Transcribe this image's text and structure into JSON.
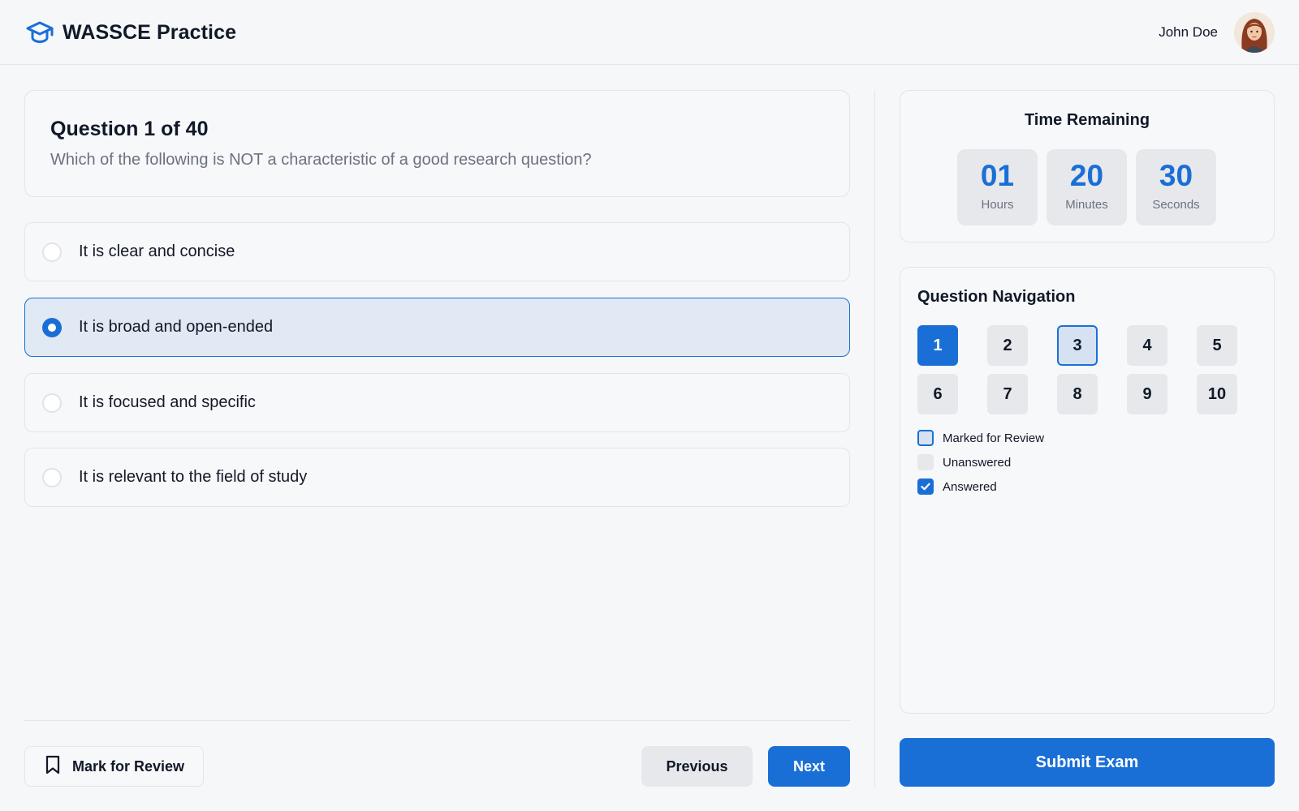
{
  "header": {
    "brand_title": "WASSCE Practice",
    "brand_icon": "graduation-cap-icon",
    "user_name": "John Doe"
  },
  "question": {
    "title": "Question 1 of 40",
    "text": "Which of the following is NOT a characteristic of a good research question?",
    "options": [
      {
        "label": "It is clear and concise",
        "selected": false
      },
      {
        "label": "It is broad and open-ended",
        "selected": true
      },
      {
        "label": "It is focused and specific",
        "selected": false
      },
      {
        "label": "It is relevant to the field of study",
        "selected": false
      }
    ]
  },
  "actions": {
    "mark_review_label": "Mark for Review",
    "previous_label": "Previous",
    "next_label": "Next",
    "submit_label": "Submit Exam"
  },
  "timer": {
    "title": "Time Remaining",
    "hours": "01",
    "hours_label": "Hours",
    "minutes": "20",
    "minutes_label": "Minutes",
    "seconds": "30",
    "seconds_label": "Seconds"
  },
  "navigation": {
    "title": "Question Navigation",
    "questions": [
      {
        "number": "1",
        "state": "current"
      },
      {
        "number": "2",
        "state": "unanswered"
      },
      {
        "number": "3",
        "state": "review"
      },
      {
        "number": "4",
        "state": "unanswered"
      },
      {
        "number": "5",
        "state": "unanswered"
      },
      {
        "number": "6",
        "state": "unanswered"
      },
      {
        "number": "7",
        "state": "unanswered"
      },
      {
        "number": "8",
        "state": "unanswered"
      },
      {
        "number": "9",
        "state": "unanswered"
      },
      {
        "number": "10",
        "state": "unanswered"
      }
    ],
    "legend": {
      "review": "Marked for Review",
      "unanswered": "Unanswered",
      "answered": "Answered"
    }
  },
  "colors": {
    "accent": "#1a6fd6",
    "selected_bg": "#e1eaf4",
    "muted_bg": "#e6e8eb"
  }
}
